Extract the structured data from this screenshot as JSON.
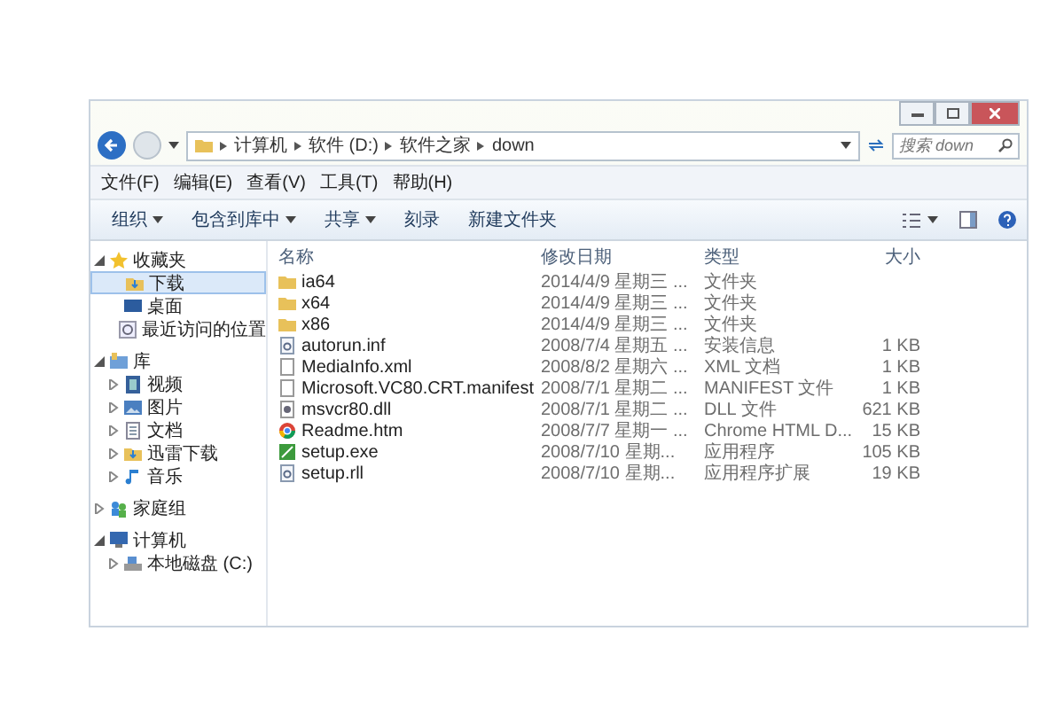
{
  "address_bar": {
    "path": [
      "计算机",
      "软件 (D:)",
      "软件之家",
      "down"
    ]
  },
  "search": {
    "placeholder": "搜索 down"
  },
  "menu_bar": [
    "文件(F)",
    "编辑(E)",
    "查看(V)",
    "工具(T)",
    "帮助(H)"
  ],
  "toolbar": [
    {
      "label": "组织",
      "has_menu": true
    },
    {
      "label": "包含到库中",
      "has_menu": true
    },
    {
      "label": "共享",
      "has_menu": true
    },
    {
      "label": "刻录",
      "has_menu": false
    },
    {
      "label": "新建文件夹",
      "has_menu": false
    }
  ],
  "sidebar": {
    "items": [
      {
        "label": "收藏夹",
        "kind": "star",
        "expanded": true,
        "selected": false,
        "children": [
          {
            "label": "下载",
            "kind": "download",
            "selected": true
          },
          {
            "label": "桌面",
            "kind": "desktop",
            "selected": false
          },
          {
            "label": "最近访问的位置",
            "kind": "recent",
            "selected": false
          }
        ]
      },
      {
        "label": "库",
        "kind": "library",
        "expanded": true,
        "selected": false,
        "children": [
          {
            "label": "视频",
            "kind": "video",
            "expanded": false,
            "selected": false
          },
          {
            "label": "图片",
            "kind": "picture",
            "expanded": false,
            "selected": false
          },
          {
            "label": "文档",
            "kind": "document",
            "expanded": false,
            "selected": false
          },
          {
            "label": "迅雷下载",
            "kind": "download",
            "expanded": false,
            "selected": false
          },
          {
            "label": "音乐",
            "kind": "music",
            "expanded": false,
            "selected": false
          }
        ]
      },
      {
        "label": "家庭组",
        "kind": "homegroup",
        "expanded": false,
        "selected": false
      },
      {
        "label": "计算机",
        "kind": "computer",
        "expanded": true,
        "selected": false,
        "children": [
          {
            "label": "本地磁盘 (C:)",
            "kind": "drive",
            "expanded": false,
            "selected": false
          }
        ]
      }
    ]
  },
  "table": {
    "columns": [
      "名称",
      "修改日期",
      "类型",
      "大小"
    ],
    "rows": [
      {
        "kind": "folder",
        "name": "ia64",
        "date": "2014/4/9 星期三 ...",
        "type": "文件夹",
        "size": ""
      },
      {
        "kind": "folder",
        "name": "x64",
        "date": "2014/4/9 星期三 ...",
        "type": "文件夹",
        "size": ""
      },
      {
        "kind": "folder",
        "name": "x86",
        "date": "2014/4/9 星期三 ...",
        "type": "文件夹",
        "size": ""
      },
      {
        "kind": "settings",
        "name": "autorun.inf",
        "date": "2008/7/4 星期五 ...",
        "type": "安装信息",
        "size": "1 KB"
      },
      {
        "kind": "file",
        "name": "MediaInfo.xml",
        "date": "2008/8/2 星期六 ...",
        "type": "XML 文档",
        "size": "1 KB"
      },
      {
        "kind": "file",
        "name": "Microsoft.VC80.CRT.manifest",
        "date": "2008/7/1 星期二 ...",
        "type": "MANIFEST 文件",
        "size": "1 KB"
      },
      {
        "kind": "gear",
        "name": "msvcr80.dll",
        "date": "2008/7/1 星期二 ...",
        "type": "DLL 文件",
        "size": "621 KB"
      },
      {
        "kind": "browser",
        "name": "Readme.htm",
        "date": "2008/7/7 星期一 ...",
        "type": "Chrome HTML D...",
        "size": "15 KB"
      },
      {
        "kind": "program",
        "name": "setup.exe",
        "date": "2008/7/10 星期...",
        "type": "应用程序",
        "size": "105 KB"
      },
      {
        "kind": "settings",
        "name": "setup.rll",
        "date": "2008/7/10 星期...",
        "type": "应用程序扩展",
        "size": "19 KB"
      }
    ]
  }
}
